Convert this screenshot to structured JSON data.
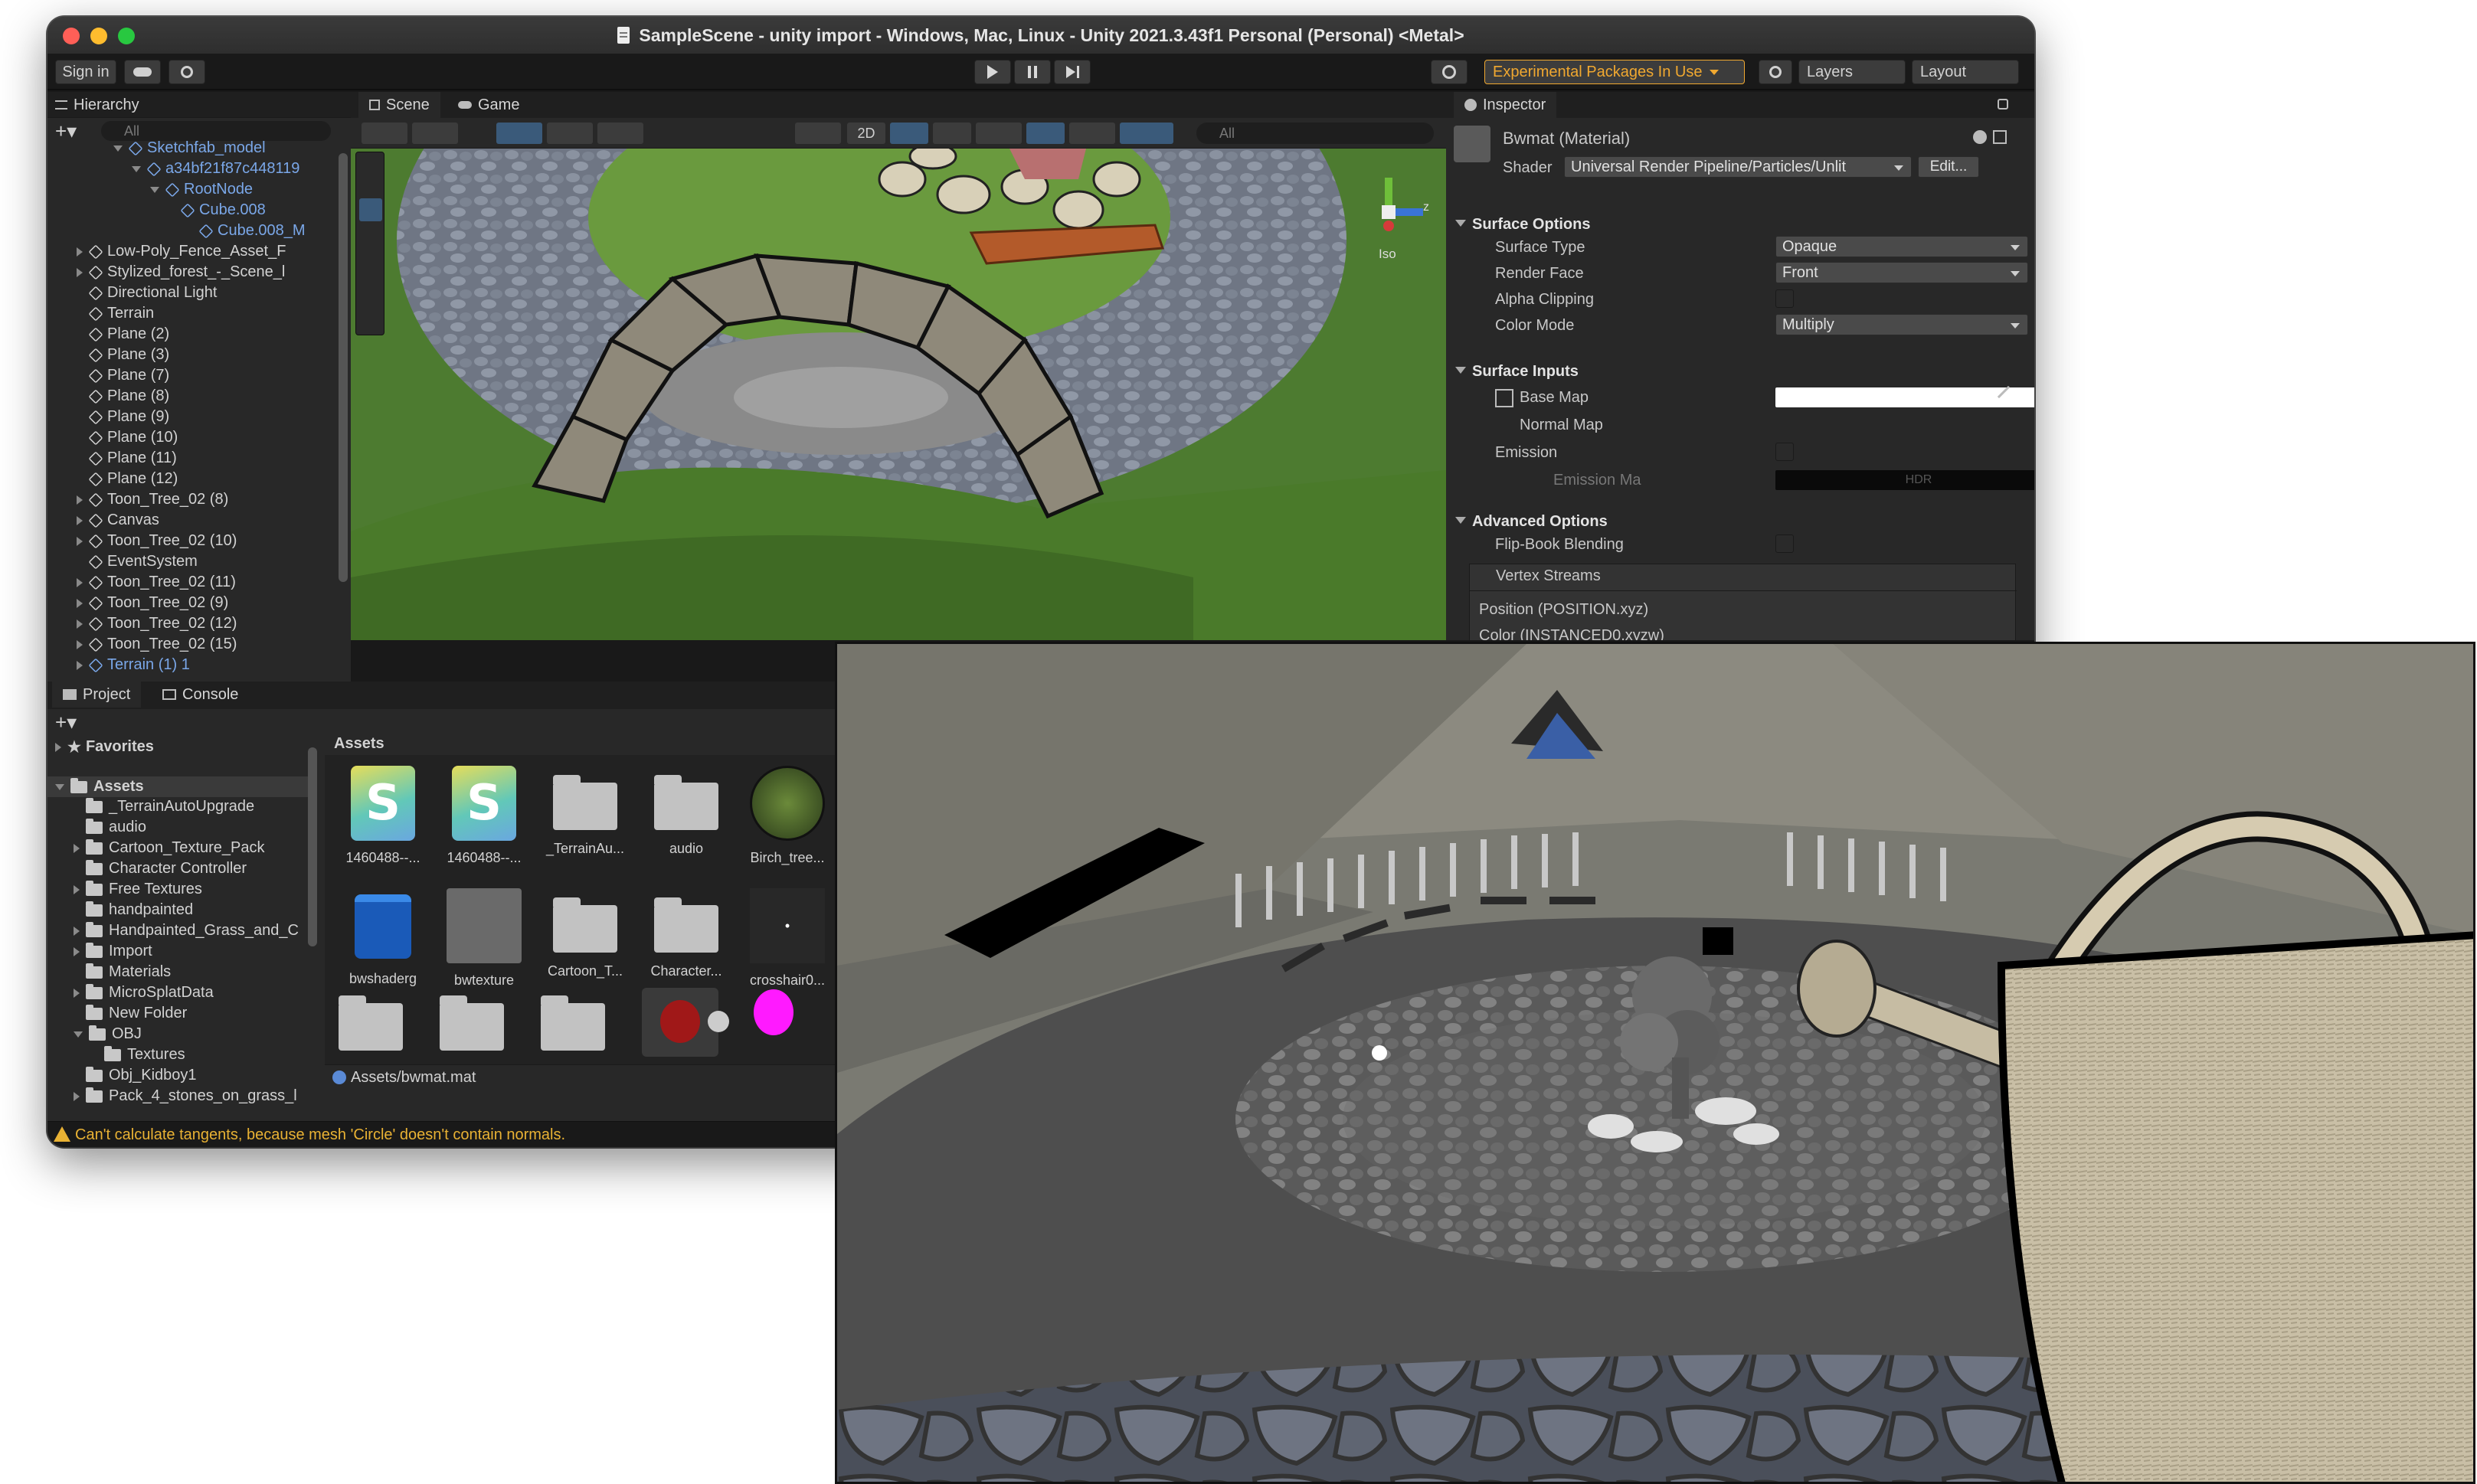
{
  "window": {
    "title": "SampleScene - unity import - Windows, Mac, Linux - Unity 2021.3.43f1 Personal (Personal) <Metal>"
  },
  "toolbar": {
    "sign_in": "Sign in",
    "experimental": "Experimental Packages In Use",
    "layers": "Layers",
    "layout": "Layout"
  },
  "hierarchy": {
    "tab": "Hierarchy",
    "search_placeholder": "All",
    "items": [
      {
        "label": "Sketchfab_model",
        "indent": 3
      },
      {
        "label": "a34bf21f87c448119",
        "indent": 4
      },
      {
        "label": "RootNode",
        "indent": 5
      },
      {
        "label": "Cube.008",
        "indent": 6
      },
      {
        "label": "Cube.008_M",
        "indent": 7
      },
      {
        "label": "Low-Poly_Fence_Asset_F",
        "indent": 1
      },
      {
        "label": "Stylized_forest_-_Scene_l",
        "indent": 1
      },
      {
        "label": "Directional Light",
        "indent": 1
      },
      {
        "label": "Terrain",
        "indent": 1
      },
      {
        "label": "Plane (2)",
        "indent": 1
      },
      {
        "label": "Plane (3)",
        "indent": 1
      },
      {
        "label": "Plane (7)",
        "indent": 1
      },
      {
        "label": "Plane (8)",
        "indent": 1
      },
      {
        "label": "Plane (9)",
        "indent": 1
      },
      {
        "label": "Plane (10)",
        "indent": 1
      },
      {
        "label": "Plane (11)",
        "indent": 1
      },
      {
        "label": "Plane (12)",
        "indent": 1
      },
      {
        "label": "Toon_Tree_02 (8)",
        "indent": 1
      },
      {
        "label": "Canvas",
        "indent": 1
      },
      {
        "label": "Toon_Tree_02 (10)",
        "indent": 1
      },
      {
        "label": "EventSystem",
        "indent": 1
      },
      {
        "label": "Toon_Tree_02 (11)",
        "indent": 1
      },
      {
        "label": "Toon_Tree_02 (9)",
        "indent": 1
      },
      {
        "label": "Toon_Tree_02 (12)",
        "indent": 1
      },
      {
        "label": "Toon_Tree_02 (15)",
        "indent": 1
      },
      {
        "label": "Terrain (1) 1",
        "indent": 1
      }
    ]
  },
  "scene": {
    "tab_scene": "Scene",
    "tab_game": "Game",
    "mode_2d": "2D",
    "search_placeholder": "All",
    "gizmo_label": "Iso",
    "axis_z": "z"
  },
  "inspector": {
    "tab": "Inspector",
    "material_name": "Bwmat (Material)",
    "shader_label": "Shader",
    "shader_value": "Universal Render Pipeline/Particles/Unlit",
    "edit": "Edit...",
    "surface_options": "Surface Options",
    "surface_type_label": "Surface Type",
    "surface_type": "Opaque",
    "render_face_label": "Render Face",
    "render_face": "Front",
    "alpha_clipping": "Alpha Clipping",
    "color_mode_label": "Color Mode",
    "color_mode": "Multiply",
    "surface_inputs": "Surface Inputs",
    "base_map": "Base Map",
    "normal_map": "Normal Map",
    "emission": "Emission",
    "emission_map": "Emission Ma",
    "hdr": "HDR",
    "advanced_options": "Advanced Options",
    "flipbook": "Flip-Book Blending",
    "vertex_streams": "Vertex Streams",
    "position": "Position (POSITION.xyz)",
    "color_partial": "Color (INSTANCED0.xyzw)"
  },
  "project": {
    "tab_project": "Project",
    "tab_console": "Console",
    "favorites": "Favorites",
    "assets_root": "Assets",
    "breadcrumb": "Assets",
    "selected_path": "Assets/bwmat.mat",
    "tree": [
      {
        "label": "_TerrainAutoUpgrade",
        "arrow": false,
        "indent": 1
      },
      {
        "label": "audio",
        "arrow": false,
        "indent": 1
      },
      {
        "label": "Cartoon_Texture_Pack",
        "arrow": true,
        "indent": 1
      },
      {
        "label": "Character Controller",
        "arrow": false,
        "indent": 1
      },
      {
        "label": "Free Textures",
        "arrow": true,
        "indent": 1
      },
      {
        "label": "handpainted",
        "arrow": false,
        "indent": 1
      },
      {
        "label": "Handpainted_Grass_and_C",
        "arrow": true,
        "indent": 1
      },
      {
        "label": "Import",
        "arrow": true,
        "indent": 1
      },
      {
        "label": "Materials",
        "arrow": false,
        "indent": 1
      },
      {
        "label": "MicroSplatData",
        "arrow": true,
        "indent": 1
      },
      {
        "label": "New Folder",
        "arrow": false,
        "indent": 1
      },
      {
        "label": "OBJ",
        "arrow": true,
        "indent": 1
      },
      {
        "label": "Textures",
        "arrow": false,
        "indent": 2
      },
      {
        "label": "Obj_Kidboy1",
        "arrow": false,
        "indent": 1
      },
      {
        "label": "Pack_4_stones_on_grass_l",
        "arrow": true,
        "indent": 1
      }
    ],
    "assets_row1": [
      "1460488--...",
      "1460488--...",
      "_TerrainAu...",
      "audio",
      "Birch_tree..."
    ],
    "assets_row2": [
      "bwshaderg",
      "bwtexture",
      "Cartoon_T...",
      "Character...",
      "crosshair0..."
    ]
  },
  "status": {
    "message": "Can't calculate tangents, because mesh 'Circle' doesn't contain normals."
  },
  "colors": {
    "accent": "#4a8ad6",
    "warning": "#e9b234",
    "experimental": "#f0a830"
  }
}
